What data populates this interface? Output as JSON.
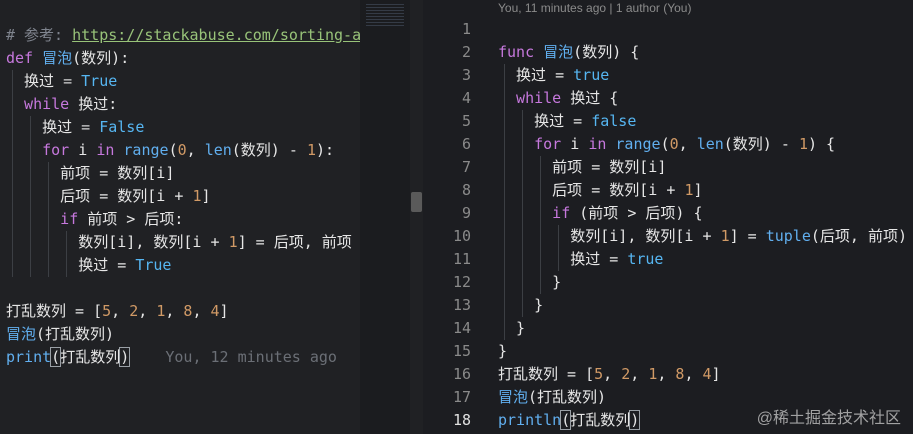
{
  "left_editor": {
    "lines": [
      [
        {
          "t": "# 参考: ",
          "c": "cm"
        },
        {
          "t": "https://stackabuse.com/sorting-a",
          "c": "url"
        }
      ],
      [
        {
          "t": "def ",
          "c": "kw"
        },
        {
          "t": "冒泡",
          "c": "fn"
        },
        {
          "t": "(数列):",
          "c": "tx"
        }
      ],
      [
        {
          "t": "  换过 ",
          "c": "tx"
        },
        {
          "t": "= ",
          "c": "op"
        },
        {
          "t": "True",
          "c": "con"
        }
      ],
      [
        {
          "t": "  while ",
          "c": "kw"
        },
        {
          "t": "换过:",
          "c": "tx"
        }
      ],
      [
        {
          "t": "    换过 ",
          "c": "tx"
        },
        {
          "t": "= ",
          "c": "op"
        },
        {
          "t": "False",
          "c": "con"
        }
      ],
      [
        {
          "t": "    for ",
          "c": "kw"
        },
        {
          "t": "i ",
          "c": "tx"
        },
        {
          "t": "in ",
          "c": "kw"
        },
        {
          "t": "range",
          "c": "fn"
        },
        {
          "t": "(",
          "c": "tx"
        },
        {
          "t": "0",
          "c": "num"
        },
        {
          "t": ", ",
          "c": "tx"
        },
        {
          "t": "len",
          "c": "fn"
        },
        {
          "t": "(数列) - ",
          "c": "tx"
        },
        {
          "t": "1",
          "c": "num"
        },
        {
          "t": "):",
          "c": "tx"
        }
      ],
      [
        {
          "t": "      前项 = 数列[i]",
          "c": "tx"
        }
      ],
      [
        {
          "t": "      后项 = 数列[i + ",
          "c": "tx"
        },
        {
          "t": "1",
          "c": "num"
        },
        {
          "t": "]",
          "c": "tx"
        }
      ],
      [
        {
          "t": "      if ",
          "c": "kw"
        },
        {
          "t": "前项 > 后项:",
          "c": "tx"
        }
      ],
      [
        {
          "t": "        数列[i], 数列[i + ",
          "c": "tx"
        },
        {
          "t": "1",
          "c": "num"
        },
        {
          "t": "] = 后项, 前项",
          "c": "tx"
        }
      ],
      [
        {
          "t": "        换过 = ",
          "c": "tx"
        },
        {
          "t": "True",
          "c": "con"
        }
      ],
      [],
      [
        {
          "t": "打乱数列 = [",
          "c": "tx"
        },
        {
          "t": "5",
          "c": "num"
        },
        {
          "t": ", ",
          "c": "tx"
        },
        {
          "t": "2",
          "c": "num"
        },
        {
          "t": ", ",
          "c": "tx"
        },
        {
          "t": "1",
          "c": "num"
        },
        {
          "t": ", ",
          "c": "tx"
        },
        {
          "t": "8",
          "c": "num"
        },
        {
          "t": ", ",
          "c": "tx"
        },
        {
          "t": "4",
          "c": "num"
        },
        {
          "t": "]",
          "c": "tx"
        }
      ],
      [
        {
          "t": "冒泡",
          "c": "fn"
        },
        {
          "t": "(打乱数列)",
          "c": "tx"
        }
      ],
      [
        {
          "t": "print",
          "c": "fn"
        },
        {
          "t": "(",
          "c": "bracket tx"
        },
        {
          "t": "打乱数列",
          "c": "tx"
        },
        {
          "t": ")",
          "c": "bracket tx"
        },
        {
          "t": "    You, 12 minutes ago",
          "c": "blame"
        }
      ]
    ]
  },
  "right_editor": {
    "blame_header": "You, 11 minutes ago | 1 author (You)",
    "line_numbers": [
      "1",
      "2",
      "3",
      "4",
      "5",
      "6",
      "7",
      "8",
      "9",
      "10",
      "11",
      "12",
      "13",
      "14",
      "15",
      "16",
      "17",
      "18"
    ],
    "active_line": 18,
    "lines": [
      [],
      [
        {
          "t": "func ",
          "c": "kw"
        },
        {
          "t": "冒泡",
          "c": "fn"
        },
        {
          "t": "(数列) {",
          "c": "tx"
        }
      ],
      [
        {
          "t": "  换过 = ",
          "c": "tx"
        },
        {
          "t": "true",
          "c": "con"
        }
      ],
      [
        {
          "t": "  while ",
          "c": "kw"
        },
        {
          "t": "换过 {",
          "c": "tx"
        }
      ],
      [
        {
          "t": "    换过 = ",
          "c": "tx"
        },
        {
          "t": "false",
          "c": "con"
        }
      ],
      [
        {
          "t": "    for ",
          "c": "kw"
        },
        {
          "t": "i ",
          "c": "tx"
        },
        {
          "t": "in ",
          "c": "kw"
        },
        {
          "t": "range",
          "c": "fn"
        },
        {
          "t": "(",
          "c": "tx"
        },
        {
          "t": "0",
          "c": "num"
        },
        {
          "t": ", ",
          "c": "tx"
        },
        {
          "t": "len",
          "c": "fn"
        },
        {
          "t": "(数列) - ",
          "c": "tx"
        },
        {
          "t": "1",
          "c": "num"
        },
        {
          "t": ") {",
          "c": "tx"
        }
      ],
      [
        {
          "t": "      前项 = 数列[i]",
          "c": "tx"
        }
      ],
      [
        {
          "t": "      后项 = 数列[i + ",
          "c": "tx"
        },
        {
          "t": "1",
          "c": "num"
        },
        {
          "t": "]",
          "c": "tx"
        }
      ],
      [
        {
          "t": "      if ",
          "c": "kw"
        },
        {
          "t": "(前项 > 后项) {",
          "c": "tx"
        }
      ],
      [
        {
          "t": "        数列[i], 数列[i + ",
          "c": "tx"
        },
        {
          "t": "1",
          "c": "num"
        },
        {
          "t": "] = ",
          "c": "tx"
        },
        {
          "t": "tuple",
          "c": "fn"
        },
        {
          "t": "(后项, 前项)",
          "c": "tx"
        }
      ],
      [
        {
          "t": "        换过 = ",
          "c": "tx"
        },
        {
          "t": "true",
          "c": "con"
        }
      ],
      [
        {
          "t": "      }",
          "c": "tx"
        }
      ],
      [
        {
          "t": "    }",
          "c": "tx"
        }
      ],
      [
        {
          "t": "  }",
          "c": "tx"
        }
      ],
      [
        {
          "t": "}",
          "c": "tx"
        }
      ],
      [
        {
          "t": "打乱数列 = [",
          "c": "tx"
        },
        {
          "t": "5",
          "c": "num"
        },
        {
          "t": ", ",
          "c": "tx"
        },
        {
          "t": "2",
          "c": "num"
        },
        {
          "t": ", ",
          "c": "tx"
        },
        {
          "t": "1",
          "c": "num"
        },
        {
          "t": ", ",
          "c": "tx"
        },
        {
          "t": "8",
          "c": "num"
        },
        {
          "t": ", ",
          "c": "tx"
        },
        {
          "t": "4",
          "c": "num"
        },
        {
          "t": "]",
          "c": "tx"
        }
      ],
      [
        {
          "t": "冒泡",
          "c": "fn"
        },
        {
          "t": "(打乱数列)",
          "c": "tx"
        }
      ],
      [
        {
          "t": "println",
          "c": "fn"
        },
        {
          "t": "(",
          "c": "bracket tx"
        },
        {
          "t": "打乱数列",
          "c": "tx"
        },
        {
          "t": ")",
          "c": "bracket tx"
        }
      ]
    ]
  },
  "watermark": "@稀土掘金技术社区"
}
